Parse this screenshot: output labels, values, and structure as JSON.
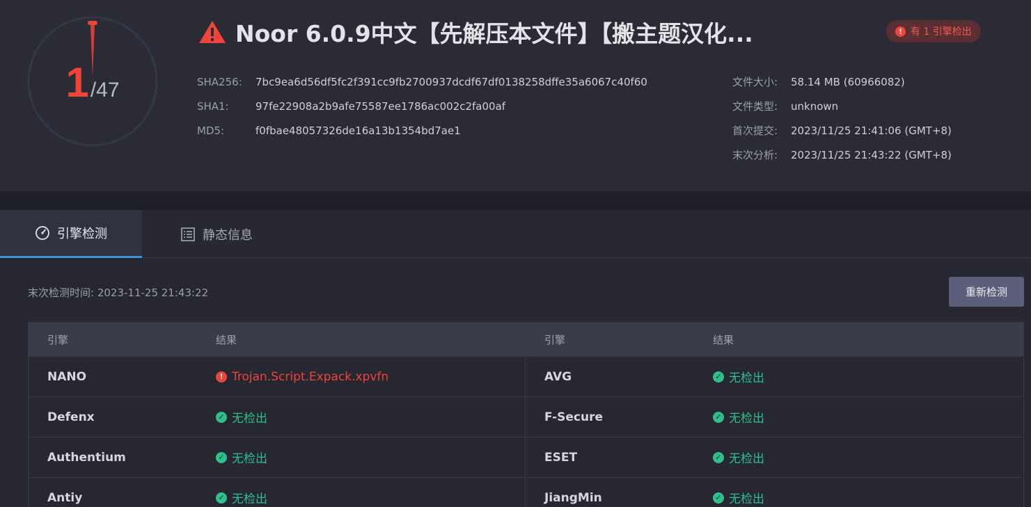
{
  "summary": {
    "detected": "1",
    "total": "/47",
    "title": "Noor 6.0.9中文【先解压本文件】【搬主题汉化...",
    "badge": "有 1 引擎检出"
  },
  "hashes": [
    {
      "label": "SHA256:",
      "value": "7bc9ea6d56df5fc2f391cc9fb2700937dcdf67df0138258dffe35a6067c40f60"
    },
    {
      "label": "SHA1:",
      "value": "97fe22908a2b9afe75587ee1786ac002c2fa00af"
    },
    {
      "label": "MD5:",
      "value": "f0fbae48057326de16a13b1354bd7ae1"
    }
  ],
  "meta": [
    {
      "label": "文件大小:",
      "value": "58.14 MB (60966082)"
    },
    {
      "label": "文件类型:",
      "value": "unknown"
    },
    {
      "label": "首次提交:",
      "value": "2023/11/25 21:41:06 (GMT+8)"
    },
    {
      "label": "末次分析:",
      "value": "2023/11/25 21:43:22 (GMT+8)"
    }
  ],
  "tabs": [
    {
      "label": "引擎检测",
      "active": true
    },
    {
      "label": "静态信息",
      "active": false
    }
  ],
  "scan": {
    "last_scan": "末次检测时间: 2023-11-25 21:43:22",
    "rescan_label": "重新检测"
  },
  "table": {
    "headers": [
      "引擎",
      "结果",
      "引擎",
      "结果"
    ],
    "rows": [
      {
        "left_engine": "NANO",
        "left_result": "Trojan.Script.Expack.xpvfn",
        "right_engine": "AVG",
        "right_result": "无检出"
      },
      {
        "left_engine": "Defenx",
        "left_result": "无检出",
        "right_engine": "F-Secure",
        "right_result": "无检出"
      },
      {
        "left_engine": "Authentium",
        "left_result": "无检出",
        "right_engine": "ESET",
        "right_result": "无检出"
      },
      {
        "left_engine": "Antiy",
        "left_result": "无检出",
        "right_engine": "JiangMin",
        "right_result": "无检出"
      }
    ]
  },
  "colors": {
    "danger": "#f0433a",
    "clean": "#2fbf8d",
    "tab_accent": "#3b97d3"
  }
}
